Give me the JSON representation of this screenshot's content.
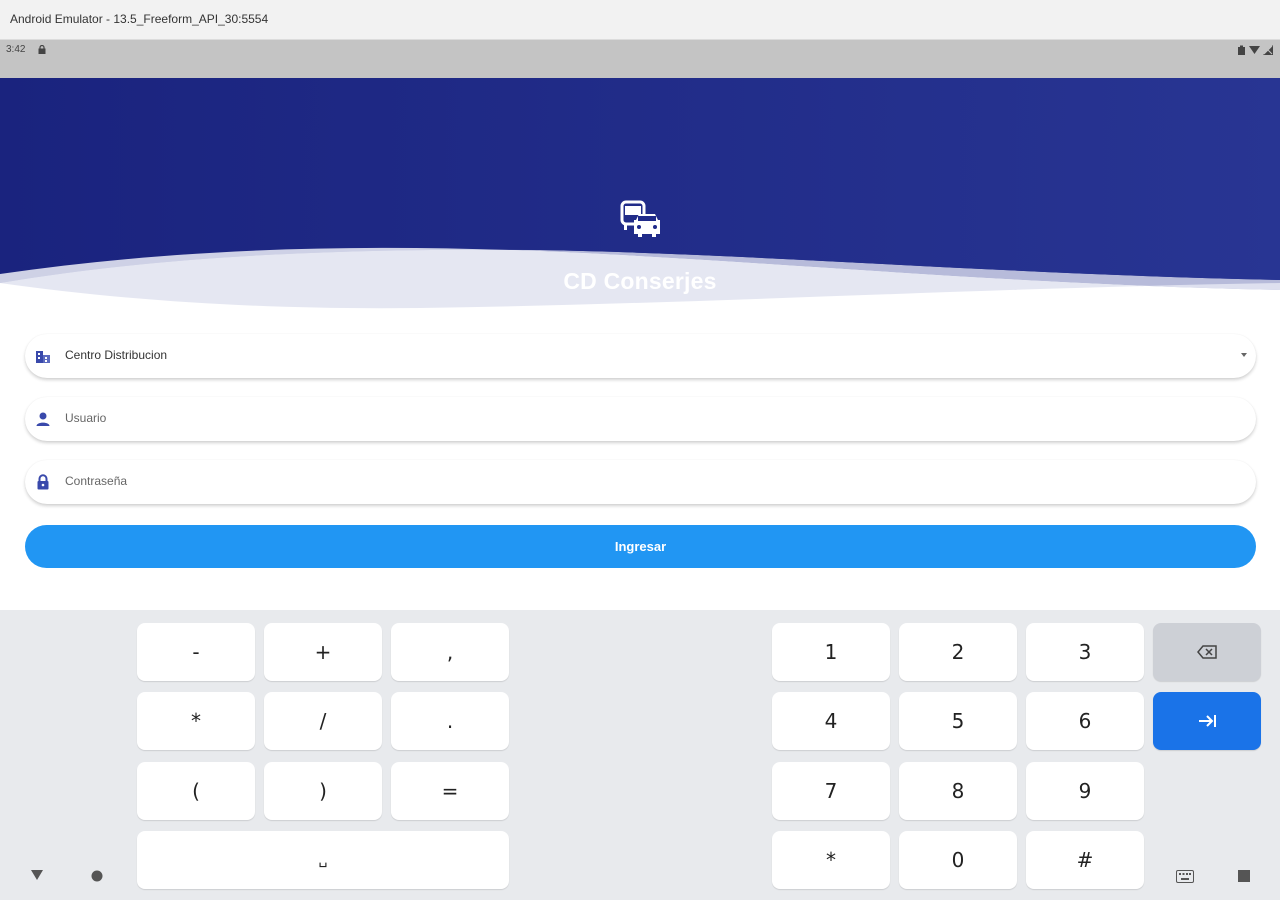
{
  "window": {
    "title": "Android Emulator - 13.5_Freeform_API_30:5554"
  },
  "status_bar": {
    "time": "3:42"
  },
  "app": {
    "title": "CD Conserjes",
    "logo_icon": "vehicles-icon"
  },
  "colors": {
    "header": "#1a237e",
    "primary_button": "#2196f3",
    "keyboard_bg": "#e8eaed",
    "enter_key": "#1a73e8"
  },
  "form": {
    "distribution_center": {
      "value": "Centro Distribucion",
      "icon": "building-icon"
    },
    "user": {
      "placeholder": "Usuario",
      "icon": "person-icon"
    },
    "password": {
      "placeholder": "Contraseña",
      "icon": "lock-icon"
    },
    "submit_label": "Ingresar"
  },
  "keyboard": {
    "symbols": [
      "-",
      "+",
      ",",
      "*",
      "/",
      ".",
      "(",
      ")",
      "=",
      "␣"
    ],
    "digits": [
      "1",
      "2",
      "3",
      "4",
      "5",
      "6",
      "7",
      "8",
      "9",
      "*",
      "0",
      "#"
    ],
    "backspace_icon": "backspace-icon",
    "enter_icon": "tab-enter-icon"
  }
}
